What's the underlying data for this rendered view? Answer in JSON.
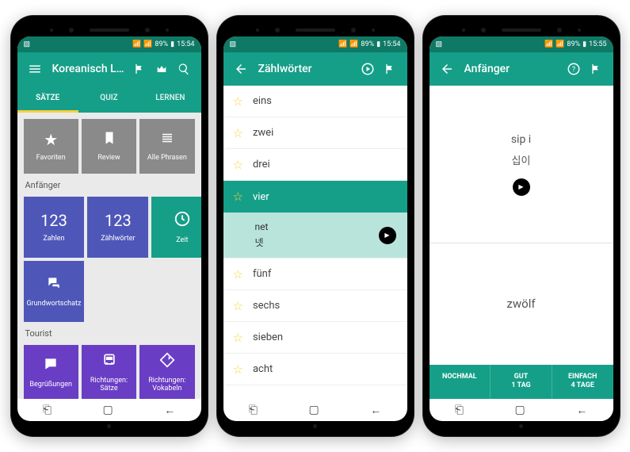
{
  "status": {
    "battery": "89%",
    "time1": "15:54",
    "time2": "15:55"
  },
  "phone1": {
    "title": "Koreanisch L…",
    "tabs": [
      "SÄTZE",
      "QUIZ",
      "LERNEN"
    ],
    "tiles_top": [
      {
        "label": "Favoriten"
      },
      {
        "label": "Review"
      },
      {
        "label": "Alle Phrasen"
      }
    ],
    "section1": "Anfänger",
    "tiles_mid": [
      {
        "icon": "123",
        "label": "Zahlen"
      },
      {
        "icon": "123",
        "label": "Zählwörter"
      },
      {
        "label": "Zeit"
      },
      {
        "label": "Grundwortschatz"
      }
    ],
    "section2": "Tourist",
    "tiles_bot": [
      {
        "label": "Begrüßungen"
      },
      {
        "label": "Richtungen: Sätze"
      },
      {
        "label": "Richtungen: Vokabeln"
      }
    ]
  },
  "phone2": {
    "title": "Zählwörter",
    "items": [
      "eins",
      "zwei",
      "drei",
      "vier",
      "fünf",
      "sechs",
      "sieben",
      "acht"
    ],
    "sub": {
      "roman": "net",
      "native": "넷"
    }
  },
  "phone3": {
    "title": "Anfänger",
    "roman": "sip i",
    "native": "십이",
    "answer": "zwölf",
    "btns": [
      {
        "l1": "NOCHMAL",
        "l2": ""
      },
      {
        "l1": "GUT",
        "l2": "1 TAG"
      },
      {
        "l1": "EINFACH",
        "l2": "4 TAGE"
      }
    ]
  }
}
